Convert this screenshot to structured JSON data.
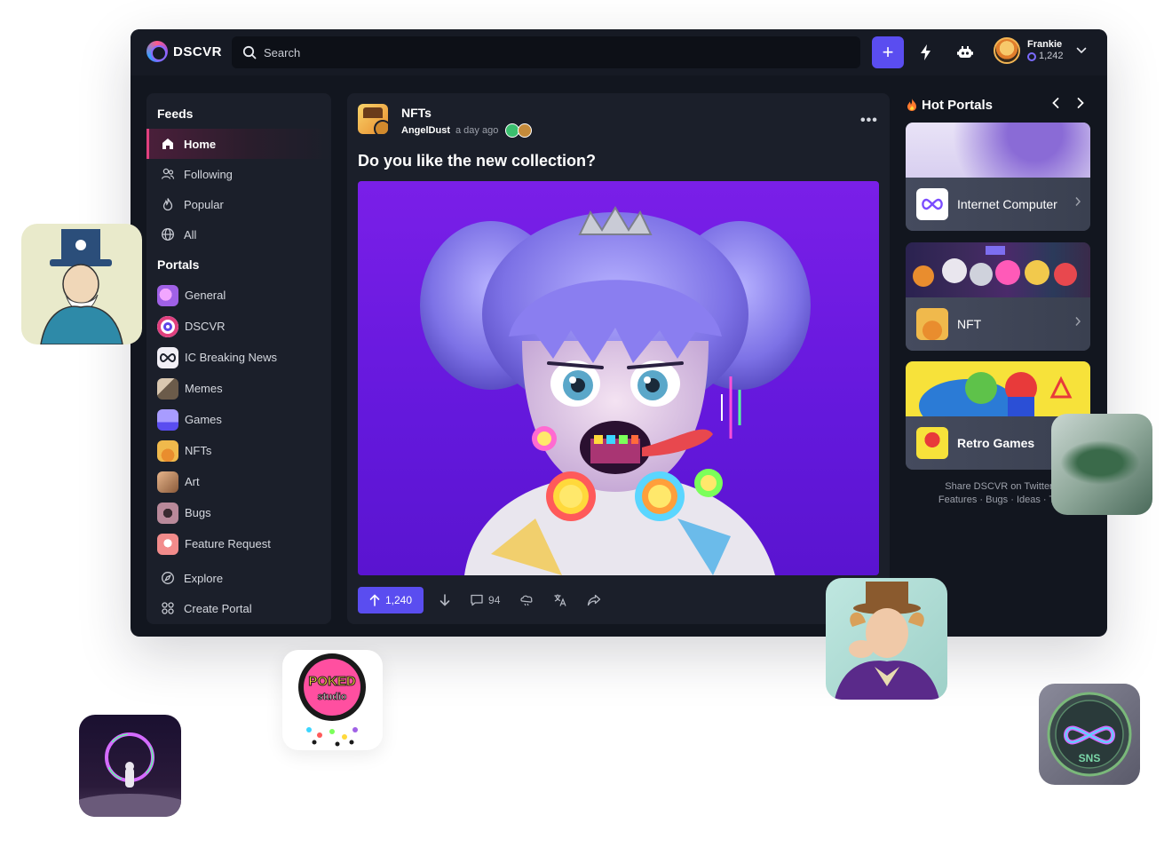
{
  "topbar": {
    "logo_text": "DSCVR",
    "search_placeholder": "Search",
    "create_label": "+",
    "user_name": "Frankie",
    "user_points": "1,242"
  },
  "sidebar": {
    "feeds_title": "Feeds",
    "feeds": [
      {
        "label": "Home",
        "icon": "home-icon",
        "active": true
      },
      {
        "label": "Following",
        "icon": "users-icon"
      },
      {
        "label": "Popular",
        "icon": "flame-icon"
      },
      {
        "label": "All",
        "icon": "globe-icon"
      }
    ],
    "portals_title": "Portals",
    "portals": [
      {
        "label": "General",
        "color": "#a061e6"
      },
      {
        "label": "DSCVR",
        "color": "#5e46e8"
      },
      {
        "label": "IC Breaking News",
        "color": "#f1eff6"
      },
      {
        "label": "Memes",
        "color": "#6b5b4a"
      },
      {
        "label": "Games",
        "color": "#7d6ef0"
      },
      {
        "label": "NFTs",
        "color": "#f0b94c"
      },
      {
        "label": "Art",
        "color": "#c98e5e"
      },
      {
        "label": "Bugs",
        "color": "#9a6a7a"
      },
      {
        "label": "Feature Request",
        "color": "#f28b8b"
      }
    ],
    "explore_label": "Explore",
    "create_portal_label": "Create Portal"
  },
  "post": {
    "portal": "NFTs",
    "author": "AngelDust",
    "time": "a day ago",
    "title": "Do you like the new collection?",
    "upvotes": "1,240",
    "comments": "94"
  },
  "hot_portals": {
    "title": "Hot Portals",
    "cards": [
      {
        "label": "Internet Computer"
      },
      {
        "label": "NFT"
      },
      {
        "label": "Retro Games"
      }
    ],
    "share_line1": "Share DSCVR on Twitter",
    "share_line2": "Features · Bugs · Ideas · Te"
  },
  "colors": {
    "accent": "#5a4df0",
    "active_pink": "#e0407e",
    "app_bg": "#12161f",
    "panel_bg": "#1b1f2a"
  }
}
